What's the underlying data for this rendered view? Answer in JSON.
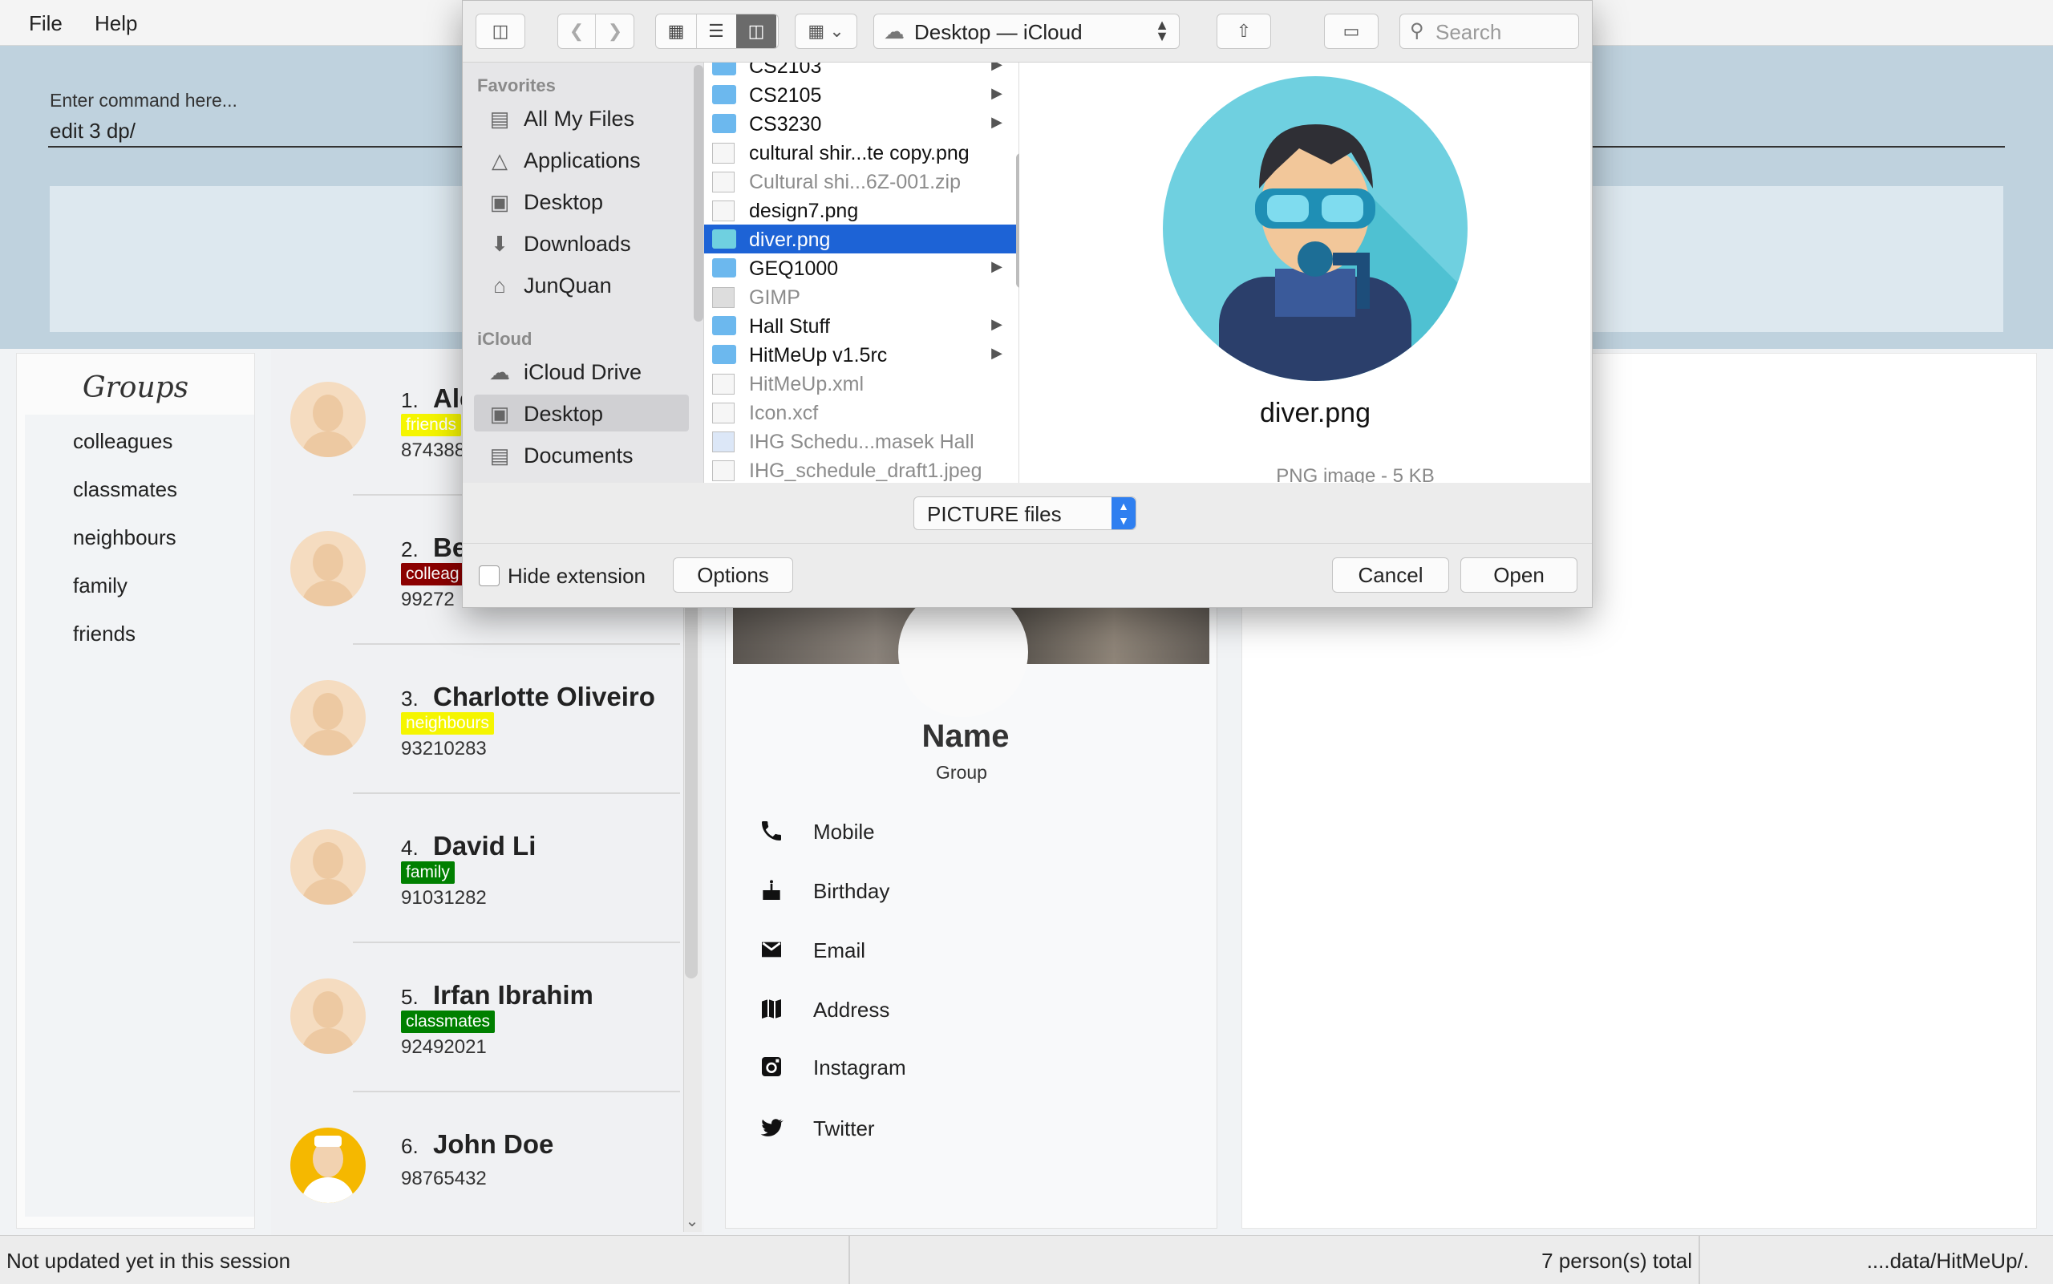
{
  "menubar": {
    "file": "File",
    "help": "Help"
  },
  "command": {
    "placeholder": "Enter command here...",
    "value": "edit 3 dp/"
  },
  "groups": {
    "title": "Groups",
    "items": [
      "colleagues",
      "classmates",
      "neighbours",
      "family",
      "friends"
    ]
  },
  "persons": [
    {
      "index": "1.",
      "name": "Ale",
      "tag": "friends",
      "tag_color": "#f5f500",
      "phone": "874388"
    },
    {
      "index": "2.",
      "name": "Be",
      "tag": "colleag",
      "tag_color": "#8b0000",
      "phone": "99272"
    },
    {
      "index": "3.",
      "name": "Charlotte Oliveiro",
      "tag": "neighbours",
      "tag_color": "#f5f500",
      "phone": "93210283"
    },
    {
      "index": "4.",
      "name": "David Li",
      "tag": "family",
      "tag_color": "#008000",
      "phone": "91031282"
    },
    {
      "index": "5.",
      "name": "Irfan Ibrahim",
      "tag": "classmates",
      "tag_color": "#008000",
      "phone": "92492021"
    },
    {
      "index": "6.",
      "name": "John Doe",
      "tag": "",
      "tag_color": "",
      "phone": "98765432"
    }
  ],
  "detail": {
    "name": "Name",
    "group": "Group",
    "fields": [
      {
        "icon": "phone-icon",
        "label": "Mobile"
      },
      {
        "icon": "birthday-cake-icon",
        "label": "Birthday"
      },
      {
        "icon": "email-icon",
        "label": "Email"
      },
      {
        "icon": "map-icon",
        "label": "Address"
      },
      {
        "icon": "instagram-icon",
        "label": "Instagram"
      },
      {
        "icon": "twitter-icon",
        "label": "Twitter"
      }
    ]
  },
  "statusbar": {
    "sync": "Not updated yet in this session",
    "total": "7 person(s) total",
    "path": "....data/HitMeUp/."
  },
  "dialog": {
    "location": "Desktop — iCloud",
    "search_placeholder": "Search",
    "sidebar": {
      "favorites_header": "Favorites",
      "favorites": [
        {
          "icon": "all-files-icon",
          "label": "All My Files"
        },
        {
          "icon": "applications-icon",
          "label": "Applications"
        },
        {
          "icon": "desktop-icon",
          "label": "Desktop"
        },
        {
          "icon": "downloads-icon",
          "label": "Downloads"
        },
        {
          "icon": "home-icon",
          "label": "JunQuan"
        }
      ],
      "icloud_header": "iCloud",
      "icloud": [
        {
          "icon": "cloud-icon",
          "label": "iCloud Drive"
        },
        {
          "icon": "desktop-icon",
          "label": "Desktop",
          "selected": true
        },
        {
          "icon": "documents-icon",
          "label": "Documents"
        }
      ]
    },
    "files": [
      {
        "name": "CS2103",
        "type": "folder"
      },
      {
        "name": "CS2105",
        "type": "folder"
      },
      {
        "name": "CS3230",
        "type": "folder"
      },
      {
        "name": "cultural shir...te copy.png",
        "type": "file"
      },
      {
        "name": "Cultural shi...6Z-001.zip",
        "type": "file",
        "dim": true
      },
      {
        "name": "design7.png",
        "type": "file"
      },
      {
        "name": "diver.png",
        "type": "file",
        "selected": true
      },
      {
        "name": "GEQ1000",
        "type": "folder"
      },
      {
        "name": "GIMP",
        "type": "app",
        "dim": true
      },
      {
        "name": "Hall Stuff",
        "type": "folder"
      },
      {
        "name": "HitMeUp v1.5rc",
        "type": "folder"
      },
      {
        "name": "HitMeUp.xml",
        "type": "file",
        "dim": true
      },
      {
        "name": "Icon.xcf",
        "type": "file",
        "dim": true
      },
      {
        "name": "IHG Schedu...masek Hall",
        "type": "file",
        "dim": true
      },
      {
        "name": "IHG_schedule_draft1.jpeg",
        "type": "file",
        "dim": true
      }
    ],
    "preview": {
      "name": "diver.png",
      "meta": "PNG image - 5 KB"
    },
    "format": "PICTURE files",
    "hide_extension": "Hide extension",
    "options": "Options",
    "cancel": "Cancel",
    "open": "Open"
  }
}
